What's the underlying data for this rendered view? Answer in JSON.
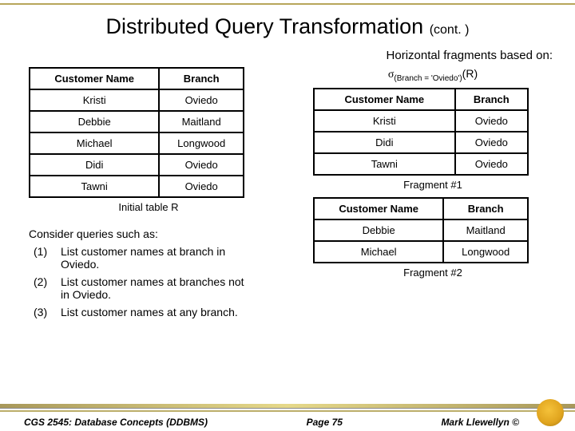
{
  "title": "Distributed Query Transformation",
  "title_suffix": "(cont. )",
  "subhead": "Horizontal fragments based on:",
  "sigma": {
    "symbol": "σ",
    "predicate": "(Branch = 'Oviedo')",
    "rel": "(R)"
  },
  "tableR": {
    "headers": [
      "Customer Name",
      "Branch"
    ],
    "rows": [
      [
        "Kristi",
        "Oviedo"
      ],
      [
        "Debbie",
        "Maitland"
      ],
      [
        "Michael",
        "Longwood"
      ],
      [
        "Didi",
        "Oviedo"
      ],
      [
        "Tawni",
        "Oviedo"
      ]
    ],
    "caption": "Initial table R"
  },
  "frag1": {
    "headers": [
      "Customer Name",
      "Branch"
    ],
    "rows": [
      [
        "Kristi",
        "Oviedo"
      ],
      [
        "Didi",
        "Oviedo"
      ],
      [
        "Tawni",
        "Oviedo"
      ]
    ],
    "caption": "Fragment #1"
  },
  "frag2": {
    "headers": [
      "Customer Name",
      "Branch"
    ],
    "rows": [
      [
        "Debbie",
        "Maitland"
      ],
      [
        "Michael",
        "Longwood"
      ]
    ],
    "caption": "Fragment #2"
  },
  "consider": "Consider queries such as:",
  "queries": [
    {
      "num": "(1)",
      "txt": "List customer names at branch in Oviedo."
    },
    {
      "num": "(2)",
      "txt": "List customer names at branches not in Oviedo."
    },
    {
      "num": "(3)",
      "txt": "List customer names at any branch."
    }
  ],
  "footer": {
    "left": "CGS 2545: Database Concepts (DDBMS)",
    "center": "Page 75",
    "right": "Mark Llewellyn ©"
  }
}
